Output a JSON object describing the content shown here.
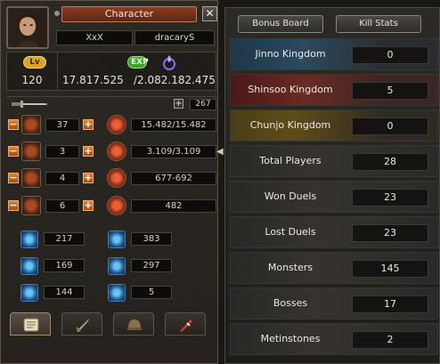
{
  "character": {
    "title": "Character",
    "close_label": "✕",
    "account_name": "XxX",
    "char_name": "dracaryS",
    "lv_badge": "Lv",
    "exp_badge": "EXP",
    "level": "120",
    "exp_current": "17.817.525",
    "exp_needed": "/2.082.182.475",
    "stat_points": "267",
    "points_plus": "+",
    "minus_label": "−",
    "plus_label": "+",
    "collapse_arrow": "◀",
    "primary_stats": [
      {
        "name": "vitality",
        "value": "37",
        "derived_name": "hp",
        "derived_value": "15.482/15.482"
      },
      {
        "name": "intelligence",
        "value": "3",
        "derived_name": "sp",
        "derived_value": "3.109/3.109"
      },
      {
        "name": "strength",
        "value": "4",
        "derived_name": "attack",
        "derived_value": "677-692"
      },
      {
        "name": "dexterity",
        "value": "6",
        "derived_name": "defense",
        "derived_value": "482"
      }
    ],
    "secondary_stats": [
      {
        "left_name": "magic-attack",
        "left_value": "217",
        "right_name": "magic-defense",
        "right_value": "383"
      },
      {
        "left_name": "attack-speed",
        "left_value": "169",
        "right_name": "dodge",
        "right_value": "297"
      },
      {
        "left_name": "move-speed",
        "left_value": "144",
        "right_name": "cast-speed",
        "right_value": "5"
      }
    ],
    "tabs": [
      {
        "name": "status",
        "icon": "scroll-icon",
        "active": true
      },
      {
        "name": "skills",
        "icon": "sword-icon",
        "active": false
      },
      {
        "name": "emotions",
        "icon": "helmet-icon",
        "active": false
      },
      {
        "name": "quests",
        "icon": "quill-icon",
        "active": false
      }
    ]
  },
  "stats_panel": {
    "tabs": {
      "bonus_board": "Bonus Board",
      "kill_stats": "Kill Stats"
    },
    "rows": [
      {
        "label": "Jinno Kingdom",
        "value": "0"
      },
      {
        "label": "Shinsoo Kingdom",
        "value": "5"
      },
      {
        "label": "Chunjo Kingdom",
        "value": "0"
      },
      {
        "label": "Total Players",
        "value": "28"
      },
      {
        "label": "Won Duels",
        "value": "23"
      },
      {
        "label": "Lost Duels",
        "value": "23"
      },
      {
        "label": "Monsters",
        "value": "145"
      },
      {
        "label": "Bosses",
        "value": "17"
      },
      {
        "label": "Metinstones",
        "value": "2"
      }
    ]
  },
  "colors": {
    "title_bar": "#8a3d22",
    "level_badge": "#d9a623",
    "exp_badge": "#3fa12b",
    "stat_button": "#e0862c"
  }
}
